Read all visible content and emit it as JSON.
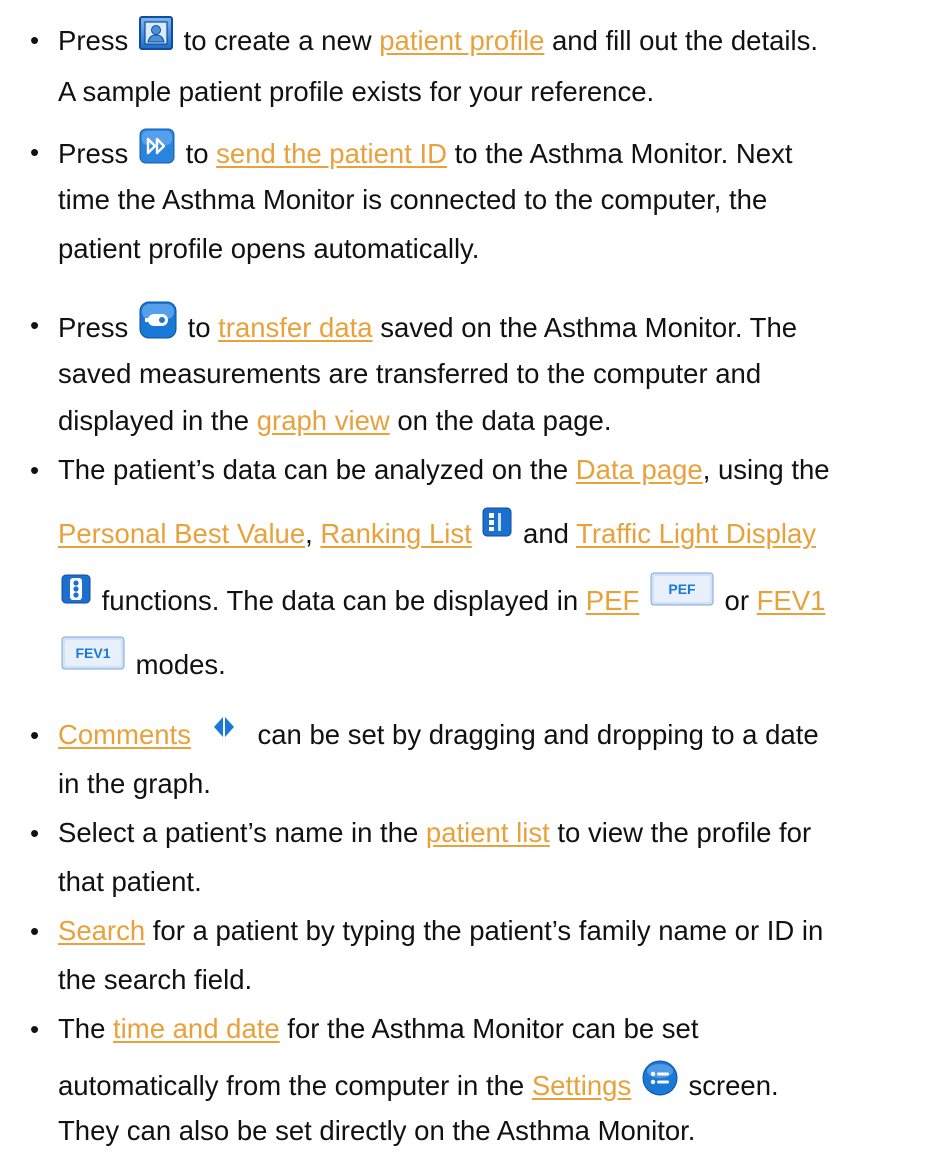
{
  "bullets": [
    {
      "lines": [
        [
          "Press ",
          "{icon:profile-icon}",
          " to create a new ",
          "{link:patient profile}",
          " and fill out the details."
        ],
        [
          "A sample patient profile exists for your reference."
        ]
      ]
    },
    {
      "lines": [
        [
          "Press ",
          "{icon:send-id-icon}",
          " to ",
          "{link:send the patient ID}",
          " to the Asthma Monitor. Next"
        ],
        [
          "time the Asthma Monitor is connected to the computer, the"
        ],
        [
          "patient profile opens automatically."
        ]
      ]
    },
    {
      "lines": [
        [
          "Press ",
          "{icon:transfer-data-icon}",
          " to ",
          "{link:transfer data}",
          " saved on the Asthma Monitor. The"
        ],
        [
          "saved measurements are transferred to the computer and"
        ],
        [
          "displayed in the ",
          "{link:graph view}",
          " on the data page."
        ]
      ]
    },
    {
      "lines": [
        [
          "The patient’s data can be analyzed on the ",
          "{link:Data page}",
          ", using the"
        ],
        [
          "{link:Personal Best Value}",
          ", ",
          "{link:Ranking List}",
          " ",
          "{icon:ranking-list-icon}",
          " and ",
          "{link:Traffic Light Display}"
        ],
        [
          "{icon:traffic-light-icon}",
          " functions. The data can be displayed in ",
          "{link:PEF}",
          " ",
          "{icon:pef-mode-icon}",
          " or ",
          "{link:FEV1}"
        ],
        [
          "{icon:fev1-mode-icon}",
          " modes."
        ]
      ]
    },
    {
      "lines": [
        [
          "{link:Comments}",
          "  ",
          "{icon:comment-marker-icon}",
          "  can be set by dragging and dropping to a date"
        ],
        [
          "in the graph."
        ]
      ]
    },
    {
      "lines": [
        [
          "Select a patient’s name in the ",
          "{link:patient list}",
          " to view the profile for"
        ],
        [
          "that patient."
        ]
      ]
    },
    {
      "lines": [
        [
          "{link:Search}",
          " for a patient by typing the patient’s family name or ID in"
        ],
        [
          "the search field."
        ]
      ]
    },
    {
      "lines": [
        [
          "The ",
          "{link:time and date}",
          " for the Asthma Monitor can be set"
        ],
        [
          "automatically from the computer in the ",
          "{link:Settings}",
          " ",
          "{icon:settings-icon}",
          " screen."
        ],
        [
          "They can also be set directly on the Asthma Monitor."
        ]
      ]
    }
  ],
  "icon_labels": {
    "pef-mode-icon": "PEF",
    "fev1-mode-icon": "FEV1"
  },
  "colors": {
    "link": "#e8a13b",
    "text": "#111111",
    "icon_blue": "#1a78d6"
  }
}
